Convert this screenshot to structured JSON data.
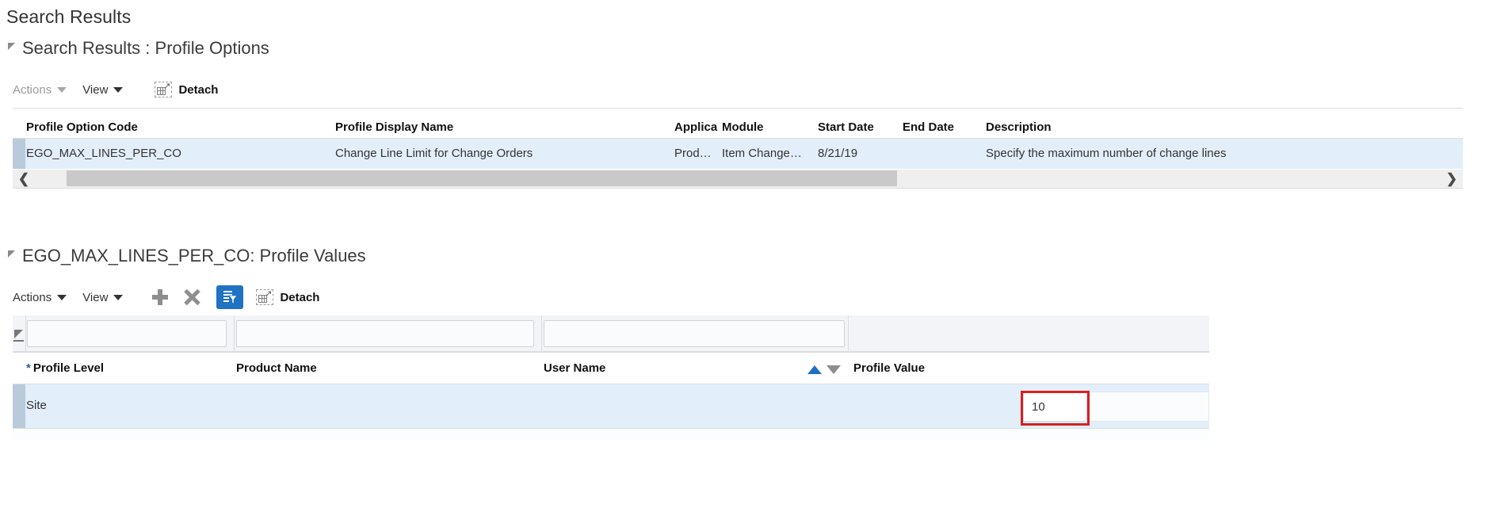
{
  "page": {
    "title": "Search Results"
  },
  "profile_options": {
    "section_title": "Search Results : Profile Options",
    "toolbar": {
      "actions_label": "Actions",
      "view_label": "View",
      "detach_label": "Detach",
      "detach_icon": "detach-icon",
      "actions_caret": "chevron-down-icon",
      "view_caret": "chevron-down-icon"
    },
    "columns": [
      "Profile Option Code",
      "Profile Display Name",
      "Applica",
      "Module",
      "Start Date",
      "End Date",
      "Description"
    ],
    "rows": [
      {
        "profile_option_code": "EGO_MAX_LINES_PER_CO",
        "profile_display_name": "Change Line Limit for Change Orders",
        "application": "Prod…",
        "module": "Item Change…",
        "start_date": "8/21/19",
        "end_date": "",
        "description": "Specify the maximum number of change lines"
      }
    ],
    "scrollbar": {
      "left_arrow": "chevron-left-icon",
      "right_arrow": "chevron-right-icon"
    }
  },
  "profile_values": {
    "section_title": "EGO_MAX_LINES_PER_CO: Profile Values",
    "toolbar": {
      "actions_label": "Actions",
      "view_label": "View",
      "add_icon": "plus-icon",
      "delete_icon": "x-icon",
      "query_by_example_icon": "filter-list-icon",
      "detach_icon": "detach-icon",
      "detach_label": "Detach"
    },
    "filter_row": {
      "edit_icon": "pencil-icon",
      "profile_level_filter": "",
      "product_name_filter": "",
      "user_name_filter": "",
      "placeholder": ""
    },
    "columns": [
      {
        "label": "Profile Level",
        "required": true,
        "required_marker": "*"
      },
      {
        "label": "Product Name",
        "required": false
      },
      {
        "label": "User Name",
        "required": false
      },
      {
        "label": "Profile Value",
        "required": false
      }
    ],
    "sort": {
      "ascending_icon": "sort-ascending-icon",
      "descending_icon": "sort-descending-icon",
      "active": "ascending"
    },
    "rows": [
      {
        "profile_level": "Site",
        "product_name": "",
        "user_name": "",
        "profile_value": "10"
      }
    ]
  },
  "annotation": {
    "highlight_color": "#d91f1f",
    "target": "profile-value-input"
  },
  "colors": {
    "accent_blue": "#2072c3",
    "row_selected": "#e2effb",
    "select_strip": "#b9cada",
    "header_text": "#111111"
  }
}
